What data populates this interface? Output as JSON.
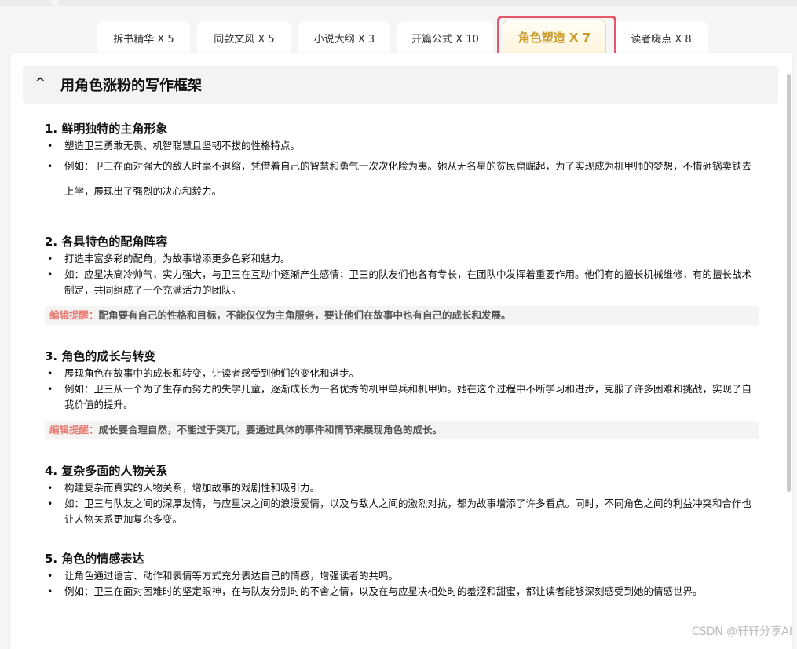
{
  "tabs": [
    {
      "label": "拆书精华 X 5",
      "active": false
    },
    {
      "label": "同款文风 X 5",
      "active": false
    },
    {
      "label": "小说大纲 X 3",
      "active": false
    },
    {
      "label": "开篇公式 X 10",
      "active": false
    },
    {
      "label": "角色塑造 X 7",
      "active": true
    },
    {
      "label": "读者嗨点 X 8",
      "active": false
    }
  ],
  "section": {
    "toggle_icon": "^",
    "title": "用角色涨粉的写作框架"
  },
  "items": [
    {
      "title": "1. 鲜明独特的主角形象",
      "bullets": [
        "塑造卫三勇敢无畏、机智聪慧且坚韧不拔的性格特点。",
        "例如：卫三在面对强大的敌人时毫不退缩，凭借着自己的智慧和勇气一次次化险为夷。她从无名星的贫民窟崛起，为了实现成为机甲师的梦想，不惜砸锅卖铁去上学，展现出了强烈的决心和毅力。"
      ]
    },
    {
      "title": "2. 各具特色的配角阵容",
      "bullets": [
        "打造丰富多彩的配角，为故事增添更多色彩和魅力。",
        "如：应星决高冷帅气，实力强大，与卫三在互动中逐渐产生感情；卫三的队友们也各有专长，在团队中发挥着重要作用。他们有的擅长机械维修，有的擅长战术制定，共同组成了一个充满活力的团队。"
      ],
      "note_label": "编辑提醒：",
      "note_text": "配角要有自己的性格和目标，不能仅仅为主角服务，要让他们在故事中也有自己的成长和发展。"
    },
    {
      "title": "3. 角色的成长与转变",
      "bullets": [
        "展现角色在故事中的成长和转变，让读者感受到他们的变化和进步。",
        "例如：卫三从一个为了生存而努力的失学儿童，逐渐成长为一名优秀的机甲单兵和机甲师。她在这个过程中不断学习和进步，克服了许多困难和挑战，实现了自我价值的提升。"
      ],
      "note_label": "编辑提醒：",
      "note_text": "成长要合理自然，不能过于突兀，要通过具体的事件和情节来展现角色的成长。"
    },
    {
      "title": "4. 复杂多面的人物关系",
      "bullets": [
        "构建复杂而真实的人物关系，增加故事的戏剧性和吸引力。",
        "如：卫三与队友之间的深厚友情，与应星决之间的浪漫爱情，以及与敌人之间的激烈对抗，都为故事增添了许多看点。同时，不同角色之间的利益冲突和合作也让人物关系更加复杂多变。"
      ]
    },
    {
      "title": "5. 角色的情感表达",
      "bullets": [
        "让角色通过语言、动作和表情等方式充分表达自己的情感，增强读者的共鸣。",
        "例如：卫三在面对困难时的坚定眼神，在与队友分别时的不舍之情，以及在与应星决相处时的羞涩和甜蜜，都让读者能够深刻感受到她的情感世界。"
      ]
    }
  ],
  "watermark": "CSDN @轩轩分享AI",
  "colors": {
    "active_tab_text": "#c99a2c",
    "highlight_border": "#e8566a",
    "note_label": "#e77b72"
  }
}
